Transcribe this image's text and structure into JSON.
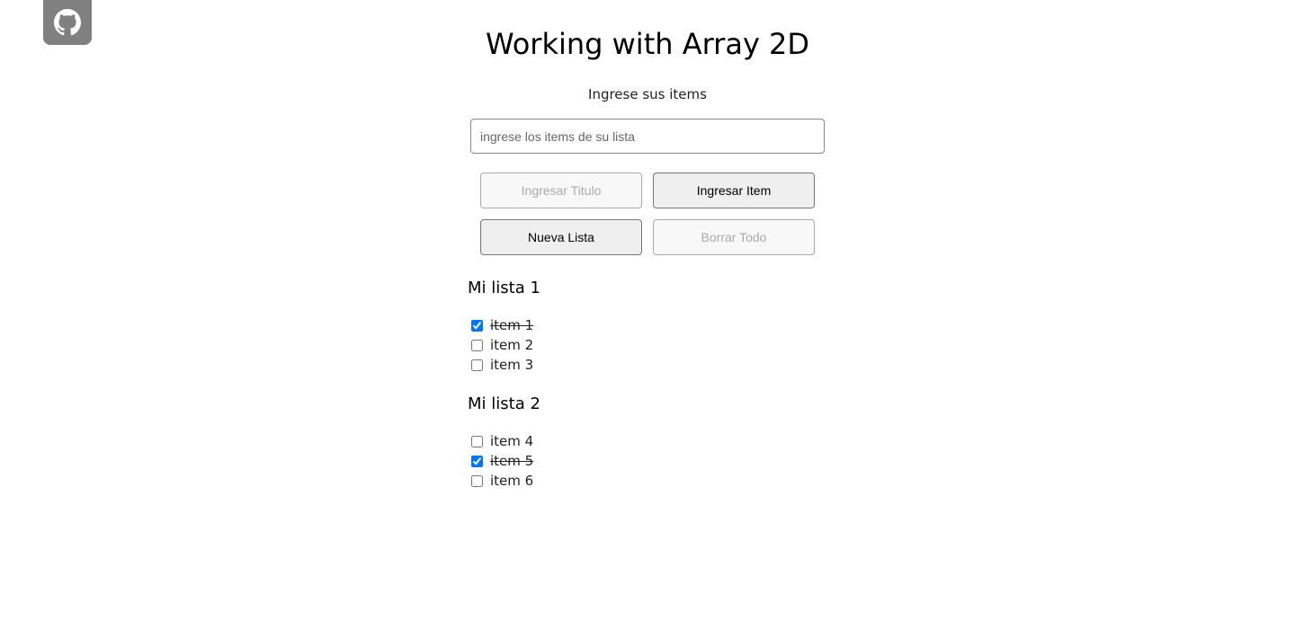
{
  "corner_link": {
    "icon": "github-icon"
  },
  "header": {
    "title": "Working with Array 2D",
    "subtitle": "Ingrese sus items"
  },
  "input": {
    "value": "",
    "placeholder": "ingrese los items de su lista"
  },
  "buttons": {
    "add_title": {
      "label": "Ingresar Titulo",
      "disabled": true
    },
    "add_item": {
      "label": "Ingresar Item",
      "disabled": false
    },
    "new_list": {
      "label": "Nueva Lista",
      "disabled": false
    },
    "clear_all": {
      "label": "Borrar Todo",
      "disabled": true
    }
  },
  "lists": [
    {
      "title": "Mi lista 1",
      "items": [
        {
          "label": "item 1",
          "checked": true
        },
        {
          "label": "item 2",
          "checked": false
        },
        {
          "label": "item 3",
          "checked": false
        }
      ]
    },
    {
      "title": "Mi lista 2",
      "items": [
        {
          "label": "item 4",
          "checked": false
        },
        {
          "label": "item 5",
          "checked": true
        },
        {
          "label": "item 6",
          "checked": false
        }
      ]
    }
  ],
  "colors": {
    "badge_bg": "#808080",
    "checkbox_accent": "#0075ff"
  }
}
